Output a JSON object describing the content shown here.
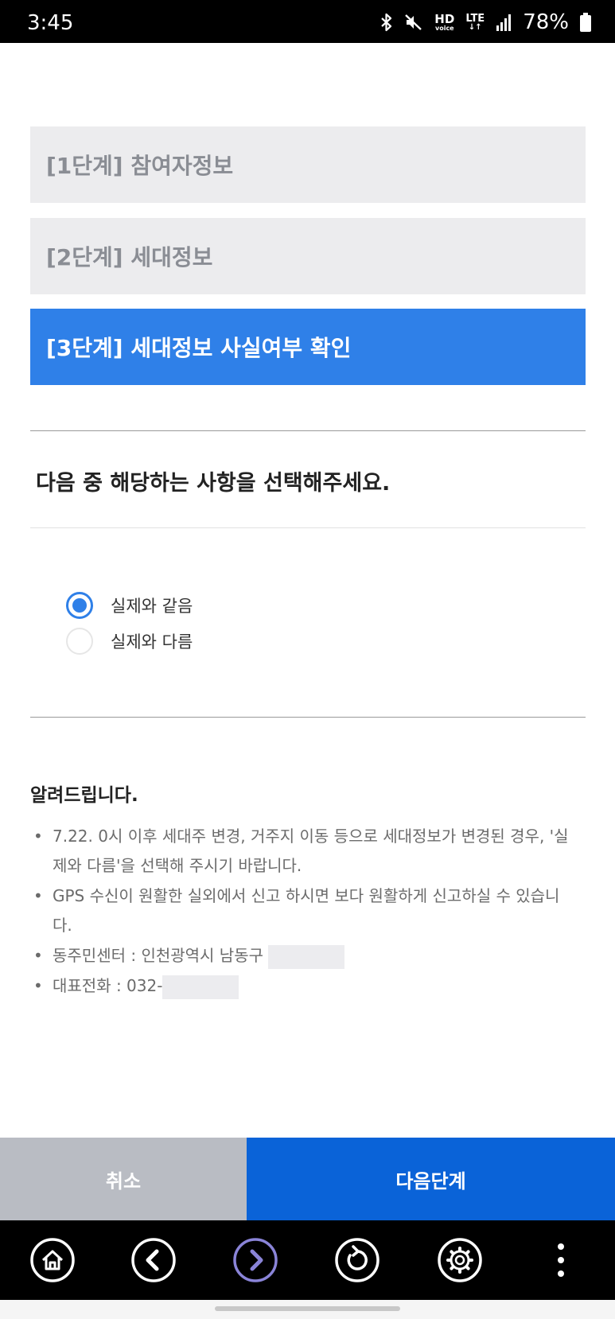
{
  "status_bar": {
    "time": "3:45",
    "hd_label": "HD",
    "voice_label": "voice",
    "lte_label": "LTE",
    "battery": "78%",
    "icons": [
      "bluetooth-icon",
      "mute-icon",
      "signal-icon",
      "battery-icon"
    ]
  },
  "steps": [
    {
      "label": "[1단계] 참여자정보",
      "active": false
    },
    {
      "label": "[2단계] 세대정보",
      "active": false
    },
    {
      "label": "[3단계] 세대정보 사실여부 확인",
      "active": true
    }
  ],
  "question": "다음 중 해당하는 사항을 선택해주세요.",
  "options": [
    {
      "label": "실제와 같음",
      "selected": true
    },
    {
      "label": "실제와 다름",
      "selected": false
    }
  ],
  "notice": {
    "title": "알려드립니다.",
    "items": [
      "7.22. 0시 이후 세대주 변경, 거주지 이동 등으로 세대정보가 변경된 경우, '실제와 다름'을 선택해 주시기 바랍니다.",
      "GPS 수신이 원활한 실외에서 신고 하시면 보다 원활하게 신고하실 수 있습니다.",
      "동주민센터 : 인천광역시 남동구",
      "대표전화 : 032-"
    ]
  },
  "buttons": {
    "cancel": "취소",
    "next": "다음단계"
  },
  "nav_bar": {
    "icons": [
      "home-icon",
      "back-icon",
      "forward-icon",
      "refresh-icon",
      "settings-icon",
      "more-icon"
    ]
  },
  "colors": {
    "accent": "#2f80e8",
    "primary_button": "#0a63d8",
    "cancel_button": "#b9bcc3",
    "inactive_step": "#ececee",
    "forward_icon": "#8a84d8"
  }
}
